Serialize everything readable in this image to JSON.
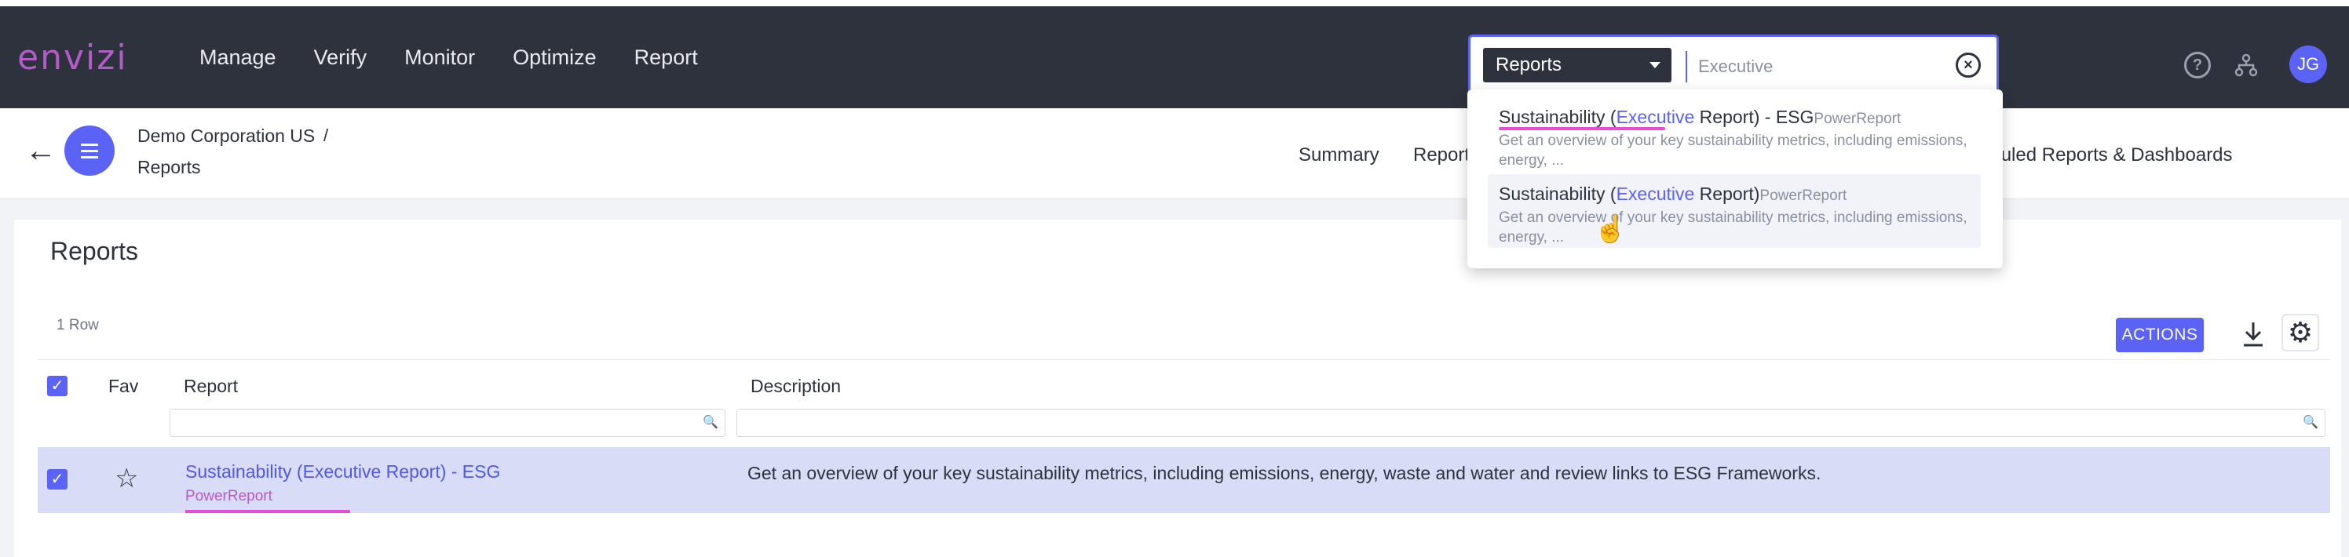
{
  "app": {
    "logo": "envizi"
  },
  "nav": [
    "Manage",
    "Verify",
    "Monitor",
    "Optimize",
    "Report"
  ],
  "search": {
    "scope": "Reports",
    "value": "Executive",
    "suggestions": [
      {
        "prefix": "Sustainability (",
        "highlight": "Executive",
        "suffix": " Report) - ESG",
        "type": "PowerReport",
        "desc": "Get an overview of your key sustainability metrics, including emissions, energy, ..."
      },
      {
        "prefix": "Sustainability (",
        "highlight": "Executive",
        "suffix": " Report)",
        "type": "PowerReport",
        "desc": "Get an overview of your key sustainability metrics, including emissions, energy, ..."
      }
    ]
  },
  "user": {
    "initials": "JG"
  },
  "breadcrumb": {
    "org": "Demo Corporation US",
    "separator": "/",
    "page": "Reports"
  },
  "tabs": {
    "summary": "Summary",
    "reports": "Report",
    "scheduled": "eduled Reports & Dashboards"
  },
  "card": {
    "title": "Reports",
    "row_count": "1 Row",
    "actions_label": "ACTIONS"
  },
  "table": {
    "headers": {
      "fav": "Fav",
      "report": "Report",
      "description": "Description"
    },
    "rows": [
      {
        "report": "Sustainability (Executive Report) - ESG",
        "type": "PowerReport",
        "description": "Get an overview of your key sustainability metrics, including emissions, energy, waste and water and review links to ESG Frameworks."
      }
    ]
  },
  "colors": {
    "accent": "#5b63f5",
    "topbar": "#2e323d",
    "brand": "#b35cc9",
    "highlight_row": "#d9dcf7",
    "underline": "#e84bd6"
  }
}
